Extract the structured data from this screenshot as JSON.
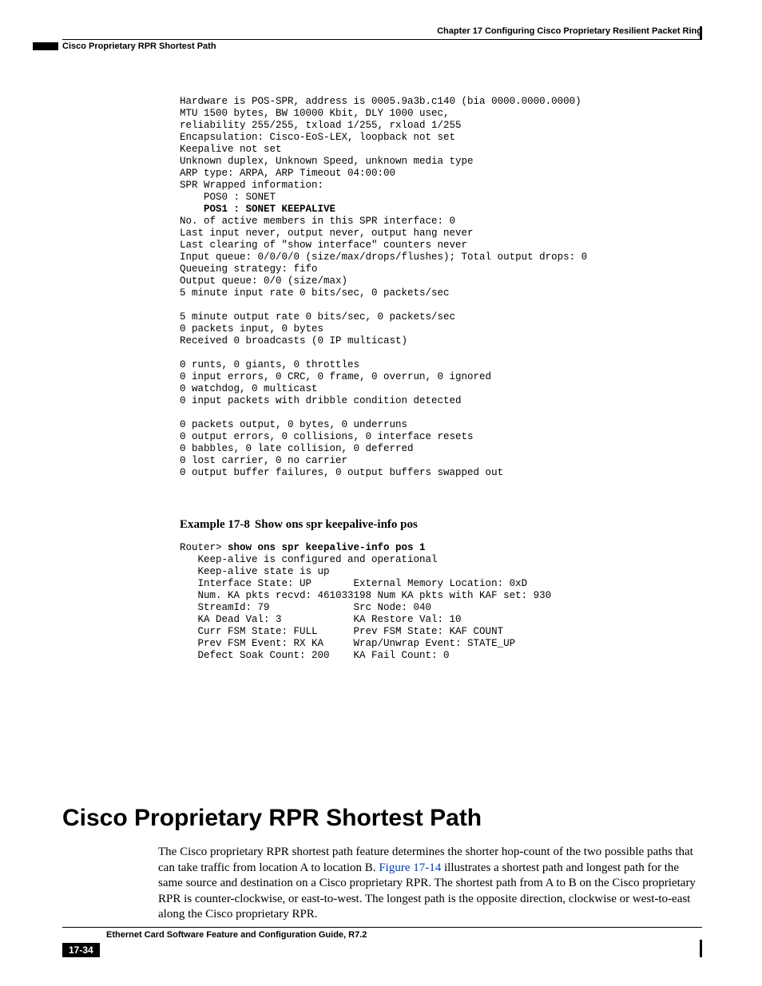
{
  "header": {
    "chapter_line": "Chapter 17  Configuring Cisco Proprietary Resilient Packet Ring",
    "section_line": "Cisco Proprietary RPR Shortest Path"
  },
  "code1": {
    "l1": "Hardware is POS-SPR, address is 0005.9a3b.c140 (bia 0000.0000.0000)",
    "l2": "MTU 1500 bytes, BW 10000 Kbit, DLY 1000 usec,",
    "l3": "reliability 255/255, txload 1/255, rxload 1/255",
    "l4": "Encapsulation: Cisco-EoS-LEX, loopback not set",
    "l5": "Keepalive not set",
    "l6": "Unknown duplex, Unknown Speed, unknown media type",
    "l7": "ARP type: ARPA, ARP Timeout 04:00:00",
    "l8": "SPR Wrapped information:",
    "l9": "    POS0 : SONET ",
    "l10": "    POS1 : SONET KEEPALIVE ",
    "l11": "No. of active members in this SPR interface: 0 ",
    "l12": "Last input never, output never, output hang never",
    "l13": "Last clearing of \"show interface\" counters never",
    "l14": "Input queue: 0/0/0/0 (size/max/drops/flushes); Total output drops: 0",
    "l15": "Queueing strategy: fifo",
    "l16": "Output queue: 0/0 (size/max)",
    "l17": "5 minute input rate 0 bits/sec, 0 packets/sec",
    "l18": "5 minute output rate 0 bits/sec, 0 packets/sec",
    "l19": "0 packets input, 0 bytes",
    "l20": "Received 0 broadcasts (0 IP multicast)",
    "l21": "0 runts, 0 giants, 0 throttles",
    "l22": "0 input errors, 0 CRC, 0 frame, 0 overrun, 0 ignored",
    "l23": "0 watchdog, 0 multicast",
    "l24": "0 input packets with dribble condition detected",
    "l25": "0 packets output, 0 bytes, 0 underruns",
    "l26": "0 output errors, 0 collisions, 0 interface resets",
    "l27": "0 babbles, 0 late collision, 0 deferred",
    "l28": "0 lost carrier, 0 no carrier",
    "l29": "0 output buffer failures, 0 output buffers swapped out"
  },
  "example": {
    "number": "Example 17-8",
    "caption": "Show ons spr keepalive-info pos"
  },
  "code2": {
    "prompt": "Router> ",
    "cmd": "show ons spr keepalive-info pos 1",
    "l1": "   Keep-alive is configured and operational",
    "l2": "   Keep-alive state is up",
    "l3": "   Interface State: UP       External Memory Location: 0xD",
    "l4": "   Num. KA pkts recvd: 461033198 Num KA pkts with KAF set: 930",
    "l5": "   StreamId: 79              Src Node: 040",
    "l6": "   KA Dead Val: 3            KA Restore Val: 10",
    "l7": "   Curr FSM State: FULL      Prev FSM State: KAF COUNT",
    "l8": "   Prev FSM Event: RX KA     Wrap/Unwrap Event: STATE_UP",
    "l9": "   Defect Soak Count: 200    KA Fail Count: 0"
  },
  "section": {
    "title": "Cisco Proprietary RPR Shortest Path",
    "para_before_link": "The Cisco proprietary RPR shortest path feature determines the shorter hop-count of the two possible paths that can take traffic from location A to location B. ",
    "link_text": "Figure 17-14",
    "para_after_link": " illustrates a shortest path and longest path for the same source and destination on a Cisco proprietary RPR. The shortest path from A to B on the Cisco proprietary RPR is counter-clockwise, or east-to-west. The longest path is the opposite direction, clockwise or west-to-east along the Cisco proprietary RPR."
  },
  "footer": {
    "guide": "Ethernet Card Software Feature and Configuration Guide, R7.2",
    "page": "17-34"
  }
}
